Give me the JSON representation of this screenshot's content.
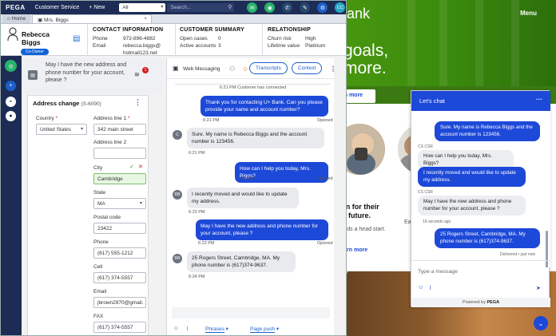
{
  "topbar": {
    "logo": "PEGA",
    "app": "Customer Service",
    "new_label": "+ New",
    "scope": "All",
    "search_placeholder": "Search...",
    "avatar": "CC"
  },
  "tabs": [
    {
      "label": "Home"
    },
    {
      "label": "Mrs. Biggs"
    }
  ],
  "customer": {
    "name": "Rebecca Biggs",
    "badge": "Co-Owner"
  },
  "contact": {
    "title": "CONTACT INFORMATION",
    "phone_k": "Phone",
    "phone_v": "972-896-4882",
    "email_k": "Email",
    "email_v": "rebecca.biggs@",
    "email_v2": "hotmail123.net"
  },
  "summary": {
    "title": "CUSTOMER SUMMARY",
    "open_k": "Open cases",
    "open_v": "0",
    "accts_k": "Active accounts",
    "accts_v": "3"
  },
  "relationship": {
    "title": "RELATIONSHIP",
    "churn_k": "Churn risk",
    "churn_v": "High",
    "ltv_k": "Lifetime value",
    "ltv_v": "Platinum"
  },
  "suggestion": {
    "text": "May I have the new address and phone number for your account, please ?",
    "badge": "1"
  },
  "address_form": {
    "title": "Address change",
    "case_id": "(S-6090)",
    "country_label": "Country",
    "country_value": "United States",
    "addr1_label": "Address line 1",
    "addr1_value": "342 main street",
    "addr2_label": "Address line 2",
    "addr2_value": "",
    "city_label": "City",
    "city_value": "Cambridge",
    "state_label": "State",
    "state_value": "MA",
    "postal_label": "Postal code",
    "postal_value": "23422",
    "phone_label": "Phone",
    "phone_value": "(617) 555-1212",
    "cell_label": "Cell",
    "cell_value": "(617) 374-5557",
    "email_label": "Email",
    "email_value": "jbrown2970@gmail.",
    "fax_label": "FAX",
    "fax_value": "(617) 374-5557"
  },
  "transcript": {
    "channel": "Web Messaging",
    "transcripts_btn": "Transcripts",
    "context_btn": "Context",
    "system": "6:21 PM Customer has connected",
    "messages": [
      {
        "from": "agent",
        "text": "Thank you for contacting U+ Bank. Can you please provide your name and account number?",
        "time": "6:21 PM",
        "status": "Opened"
      },
      {
        "from": "cust",
        "avatar": "C",
        "text": "Sure. My name is Rebecca Biggs and the account number is 123456.",
        "time": "6:21 PM"
      },
      {
        "from": "agent",
        "text": "How can I help you today, Mrs. Biggs?",
        "time": "6:22 PM",
        "status": "Opened"
      },
      {
        "from": "cust",
        "avatar": "RB",
        "text": "I recently moved and would like to update my address.",
        "time": "6:23 PM"
      },
      {
        "from": "agent",
        "text": "May I have the new address and phone number for your account, please ?",
        "time": "6:23 PM",
        "status": "Opened"
      },
      {
        "from": "cust",
        "avatar": "RB",
        "text": "25 Rogers Street, Cambridge, MA. My phone number is (617)374-9637.",
        "time": "6:24 PM"
      }
    ],
    "phrases_btn": "Phrases",
    "pagepush_btn": "Page push"
  },
  "site": {
    "brand_partial": "ank",
    "menu": "Menu",
    "hero_line1": "goals,",
    "hero_line2": "more.",
    "learn_more": "rn more",
    "card_title": "ian for their future.",
    "card_desc": "the kids a head start.",
    "card_link": "Learn more",
    "card2_partial": "Ea"
  },
  "widget": {
    "title": "Let's chat",
    "messages": [
      {
        "from": "agent",
        "text": "Sure. My name is Rebecca Biggs and the account number is 123456."
      },
      {
        "from": "label",
        "text": "CS CSR"
      },
      {
        "from": "cust",
        "text": "How can I help you today, Mrs. Biggs?"
      },
      {
        "from": "agent",
        "text": "I recently moved and would like to update my address."
      },
      {
        "from": "label",
        "text": "CS CSR"
      },
      {
        "from": "cust",
        "text": "May I have the new address and phone number for your account, please ?"
      },
      {
        "from": "label",
        "text": "19 seconds ago"
      },
      {
        "from": "agent",
        "text": "25 Rogers Street, Cambridge, MA. My phone number is (617)374-9637."
      },
      {
        "from": "label",
        "text": "Delivered • just now"
      }
    ],
    "placeholder": "Type a message",
    "powered": "Powered by",
    "powered_brand": "PEGA"
  },
  "colors": {
    "accent": "#1d49d8",
    "nav": "#1d2c55",
    "site_green": "#3b8a0d",
    "divider": "#ffb300"
  }
}
